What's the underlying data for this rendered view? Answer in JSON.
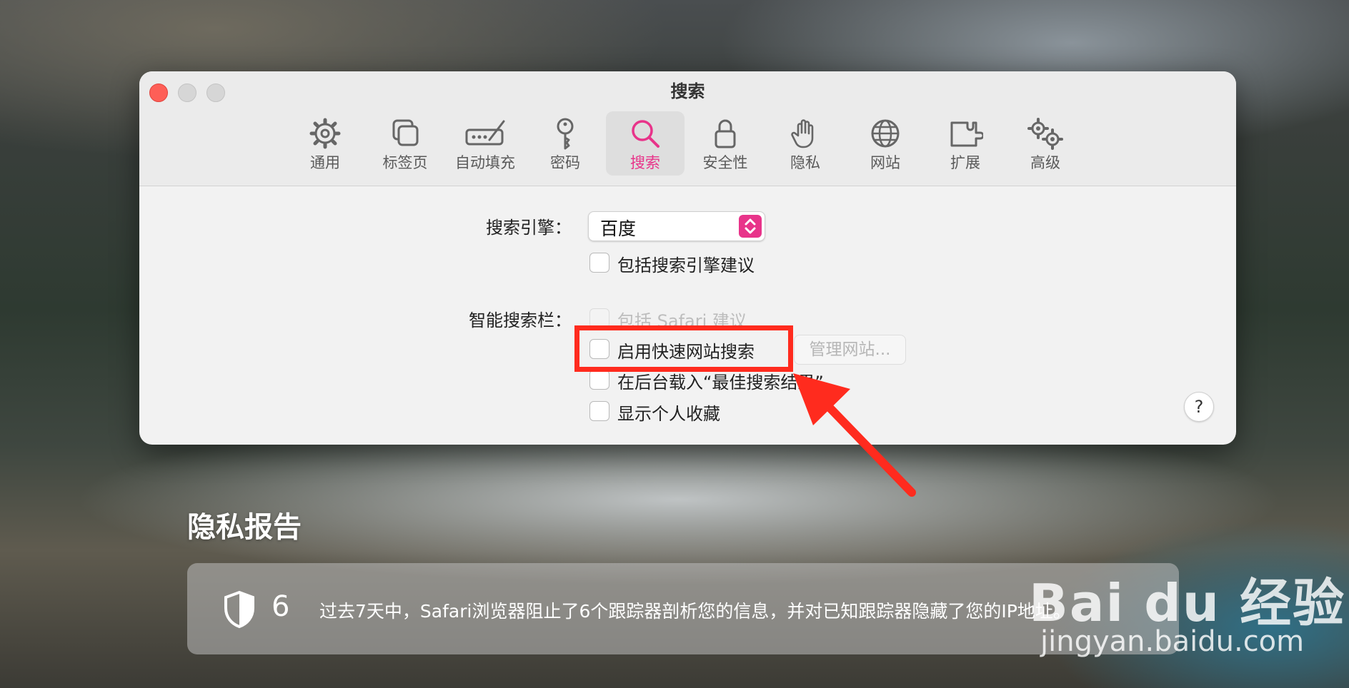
{
  "window": {
    "title": "搜索"
  },
  "tabs": [
    {
      "id": "general",
      "label": "通用",
      "icon": "gear-icon"
    },
    {
      "id": "tabs",
      "label": "标签页",
      "icon": "tabs-icon"
    },
    {
      "id": "autofill",
      "label": "自动填充",
      "icon": "autofill-pen-icon"
    },
    {
      "id": "passwords",
      "label": "密码",
      "icon": "key-icon"
    },
    {
      "id": "search",
      "label": "搜索",
      "icon": "search-icon",
      "active": true
    },
    {
      "id": "security",
      "label": "安全性",
      "icon": "lock-icon"
    },
    {
      "id": "privacy",
      "label": "隐私",
      "icon": "hand-icon"
    },
    {
      "id": "websites",
      "label": "网站",
      "icon": "globe-icon"
    },
    {
      "id": "extensions",
      "label": "扩展",
      "icon": "puzzle-icon"
    },
    {
      "id": "advanced",
      "label": "高级",
      "icon": "gears-icon"
    }
  ],
  "search_engine": {
    "label": "搜索引擎：",
    "selected": "百度",
    "include_suggestions": {
      "label": "包括搜索引擎建议",
      "checked": false
    }
  },
  "smart_search": {
    "label": "智能搜索栏：",
    "include_safari_suggestions": {
      "label": "包括 Safari 建议",
      "checked": false,
      "disabled": true
    },
    "quick_website_search": {
      "label": "启用快速网站搜索",
      "checked": false
    },
    "manage_websites_label": "管理网站...",
    "preload_top_hit": {
      "label": "在后台载入“最佳搜索结果”",
      "checked": false
    },
    "show_favorites": {
      "label": "显示个人收藏",
      "checked": false
    }
  },
  "help_label": "?",
  "privacy_report": {
    "title": "隐私报告",
    "count": "6",
    "description": "过去7天中，Safari浏览器阻止了6个跟踪器剖析您的信息，并对已知跟踪器隐藏了您的IP地址。"
  },
  "watermark": {
    "logo": "Bai du 经验",
    "url": "jingyan.baidu.com"
  },
  "colors": {
    "accent": "#e8348a",
    "highlight": "#ff2b1e",
    "close": "#fe5f57"
  }
}
